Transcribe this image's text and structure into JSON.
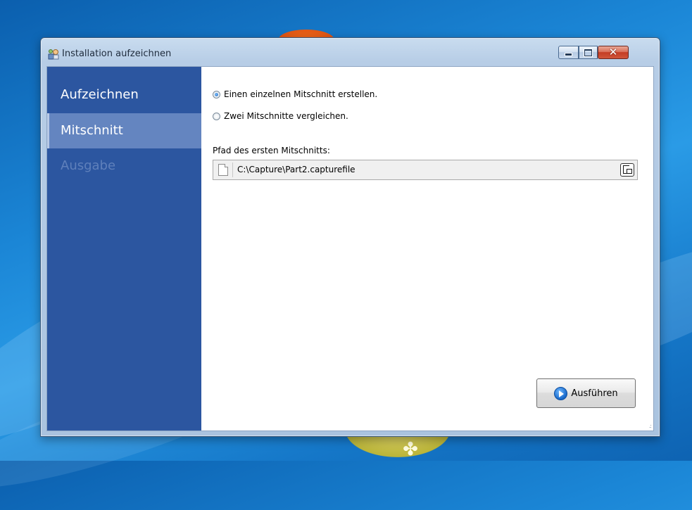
{
  "window": {
    "title": "Installation aufzeichnen",
    "controls": {
      "minimize": "minimize",
      "maximize": "maximize",
      "close": "✕"
    }
  },
  "sidebar": {
    "items": [
      {
        "label": "Aufzeichnen",
        "state": "normal"
      },
      {
        "label": "Mitschnitt",
        "state": "selected"
      },
      {
        "label": "Ausgabe",
        "state": "disabled"
      }
    ]
  },
  "content": {
    "options": [
      {
        "label": "Einen einzelnen Mitschnitt erstellen.",
        "checked": true
      },
      {
        "label": "Zwei Mitschnitte vergleichen.",
        "checked": false
      }
    ],
    "path_label": "Pfad des ersten Mitschnitts:",
    "path_value": "C:\\Capture\\Part2.capturefile",
    "run_label": "Ausführen"
  },
  "icons": {
    "app": "installer-icon",
    "file": "file-icon",
    "browse": "browse-file-icon",
    "run": "play-icon",
    "grip": "resize-grip-icon"
  },
  "colors": {
    "sidebar": "#2c56a0",
    "sidebar_selected": "#6485c0",
    "sidebar_disabled_text": "#5f80bb"
  }
}
